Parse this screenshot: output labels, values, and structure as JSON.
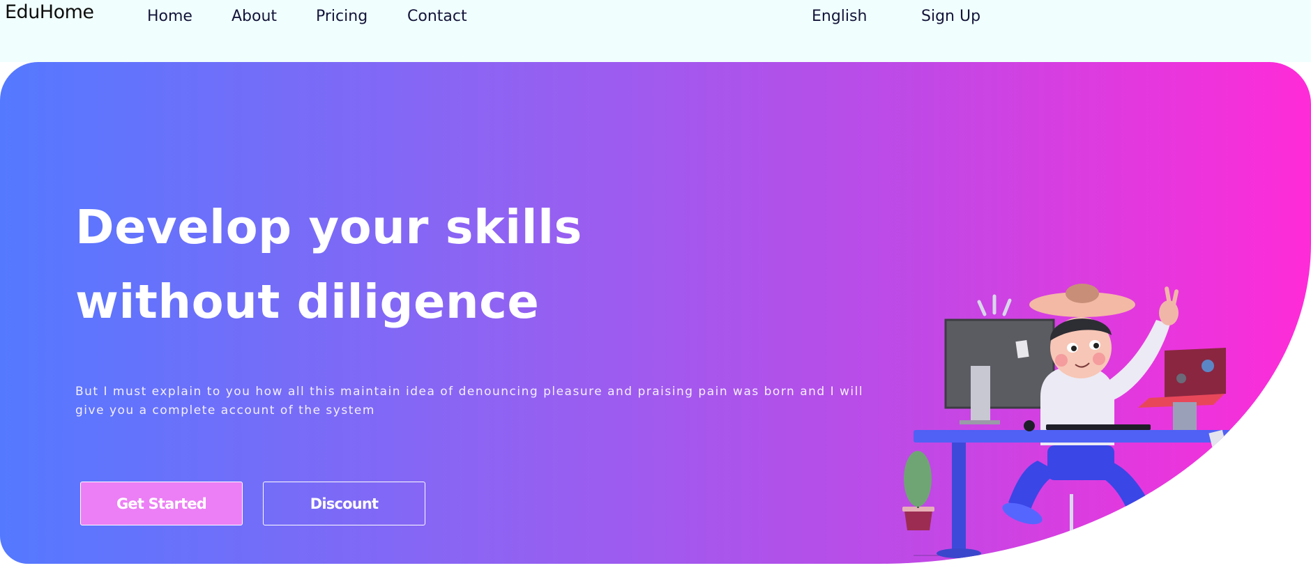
{
  "nav": {
    "logo": "EduHome",
    "links": [
      "Home",
      "About",
      "Pricing",
      "Contact"
    ],
    "language": "English",
    "signup": "Sign Up"
  },
  "hero": {
    "title": "Develop your skills without diligence",
    "description": "But I must explain to you how all this maintain idea of denouncing pleasure and praising pain was born and I will give you a complete account of the system",
    "buttons": {
      "primary": "Get Started",
      "secondary": "Discount"
    }
  },
  "colors": {
    "nav_background": "#f0fffd",
    "gradient_start": "#5479ff",
    "gradient_end": "#ff2bd8",
    "primary_button": "#ec7ff5"
  }
}
